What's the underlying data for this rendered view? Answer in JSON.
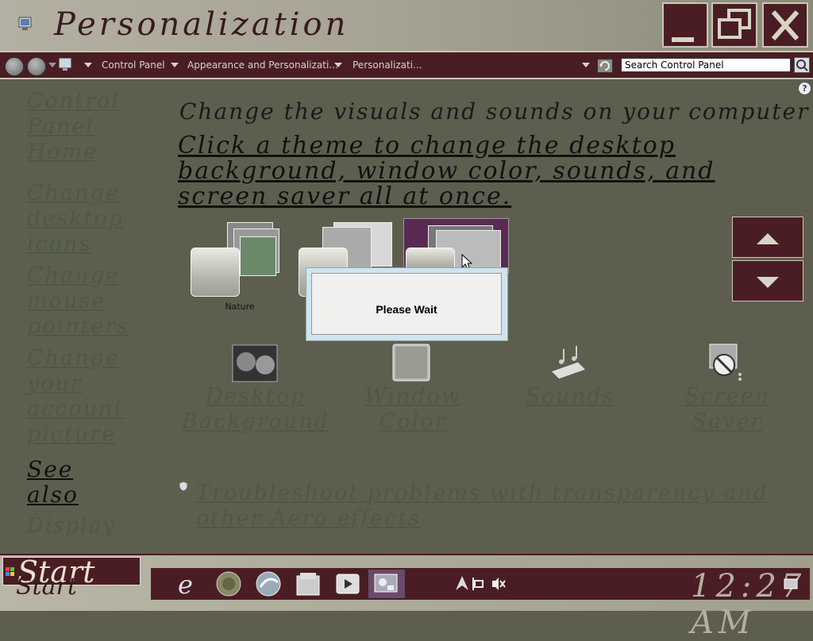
{
  "window": {
    "title": "Personalization"
  },
  "address_bar": {
    "crumbs": [
      "Control Panel",
      "Appearance and Personalizati...",
      "Personalizati..."
    ],
    "search_placeholder": "Search Control Panel"
  },
  "left_pane": {
    "links": [
      "Control Panel Home",
      "Change desktop icons",
      "Change mouse pointers",
      "Change your account picture"
    ],
    "see_also": "See also",
    "see_also_links": [
      "Display"
    ]
  },
  "main": {
    "heading": "Change the visuals and sounds on your computer",
    "subheading": "Click a theme to change the desktop background, window color, sounds, and screen saver all at once.",
    "themes": [
      {
        "label": "Nature",
        "selected": false
      },
      {
        "label": "",
        "selected": false
      },
      {
        "label": "",
        "selected": true
      }
    ],
    "dialog_text": "Please Wait",
    "bottom_items": [
      {
        "label": "Desktop Background",
        "icon": "desktop-background-icon"
      },
      {
        "label": "Window Color",
        "icon": "window-color-icon"
      },
      {
        "label": "Sounds",
        "icon": "sounds-icon"
      },
      {
        "label": "Screen Saver",
        "icon": "screen-saver-icon"
      }
    ],
    "troubleshoot_link": "Troubleshoot problems with transparency and other Aero effects"
  },
  "taskbar": {
    "start_label": "Start",
    "clock": "12:27 AM",
    "apps": [
      "internet-explorer-icon",
      "firefox-icon",
      "media-player-icon",
      "file-explorer-icon",
      "media-center-icon",
      "control-panel-icon"
    ]
  },
  "colors": {
    "accent": "#4a1d24",
    "background": "#5e5e4e",
    "link": "#4d5a42",
    "selected_theme": "#5a2a55"
  }
}
